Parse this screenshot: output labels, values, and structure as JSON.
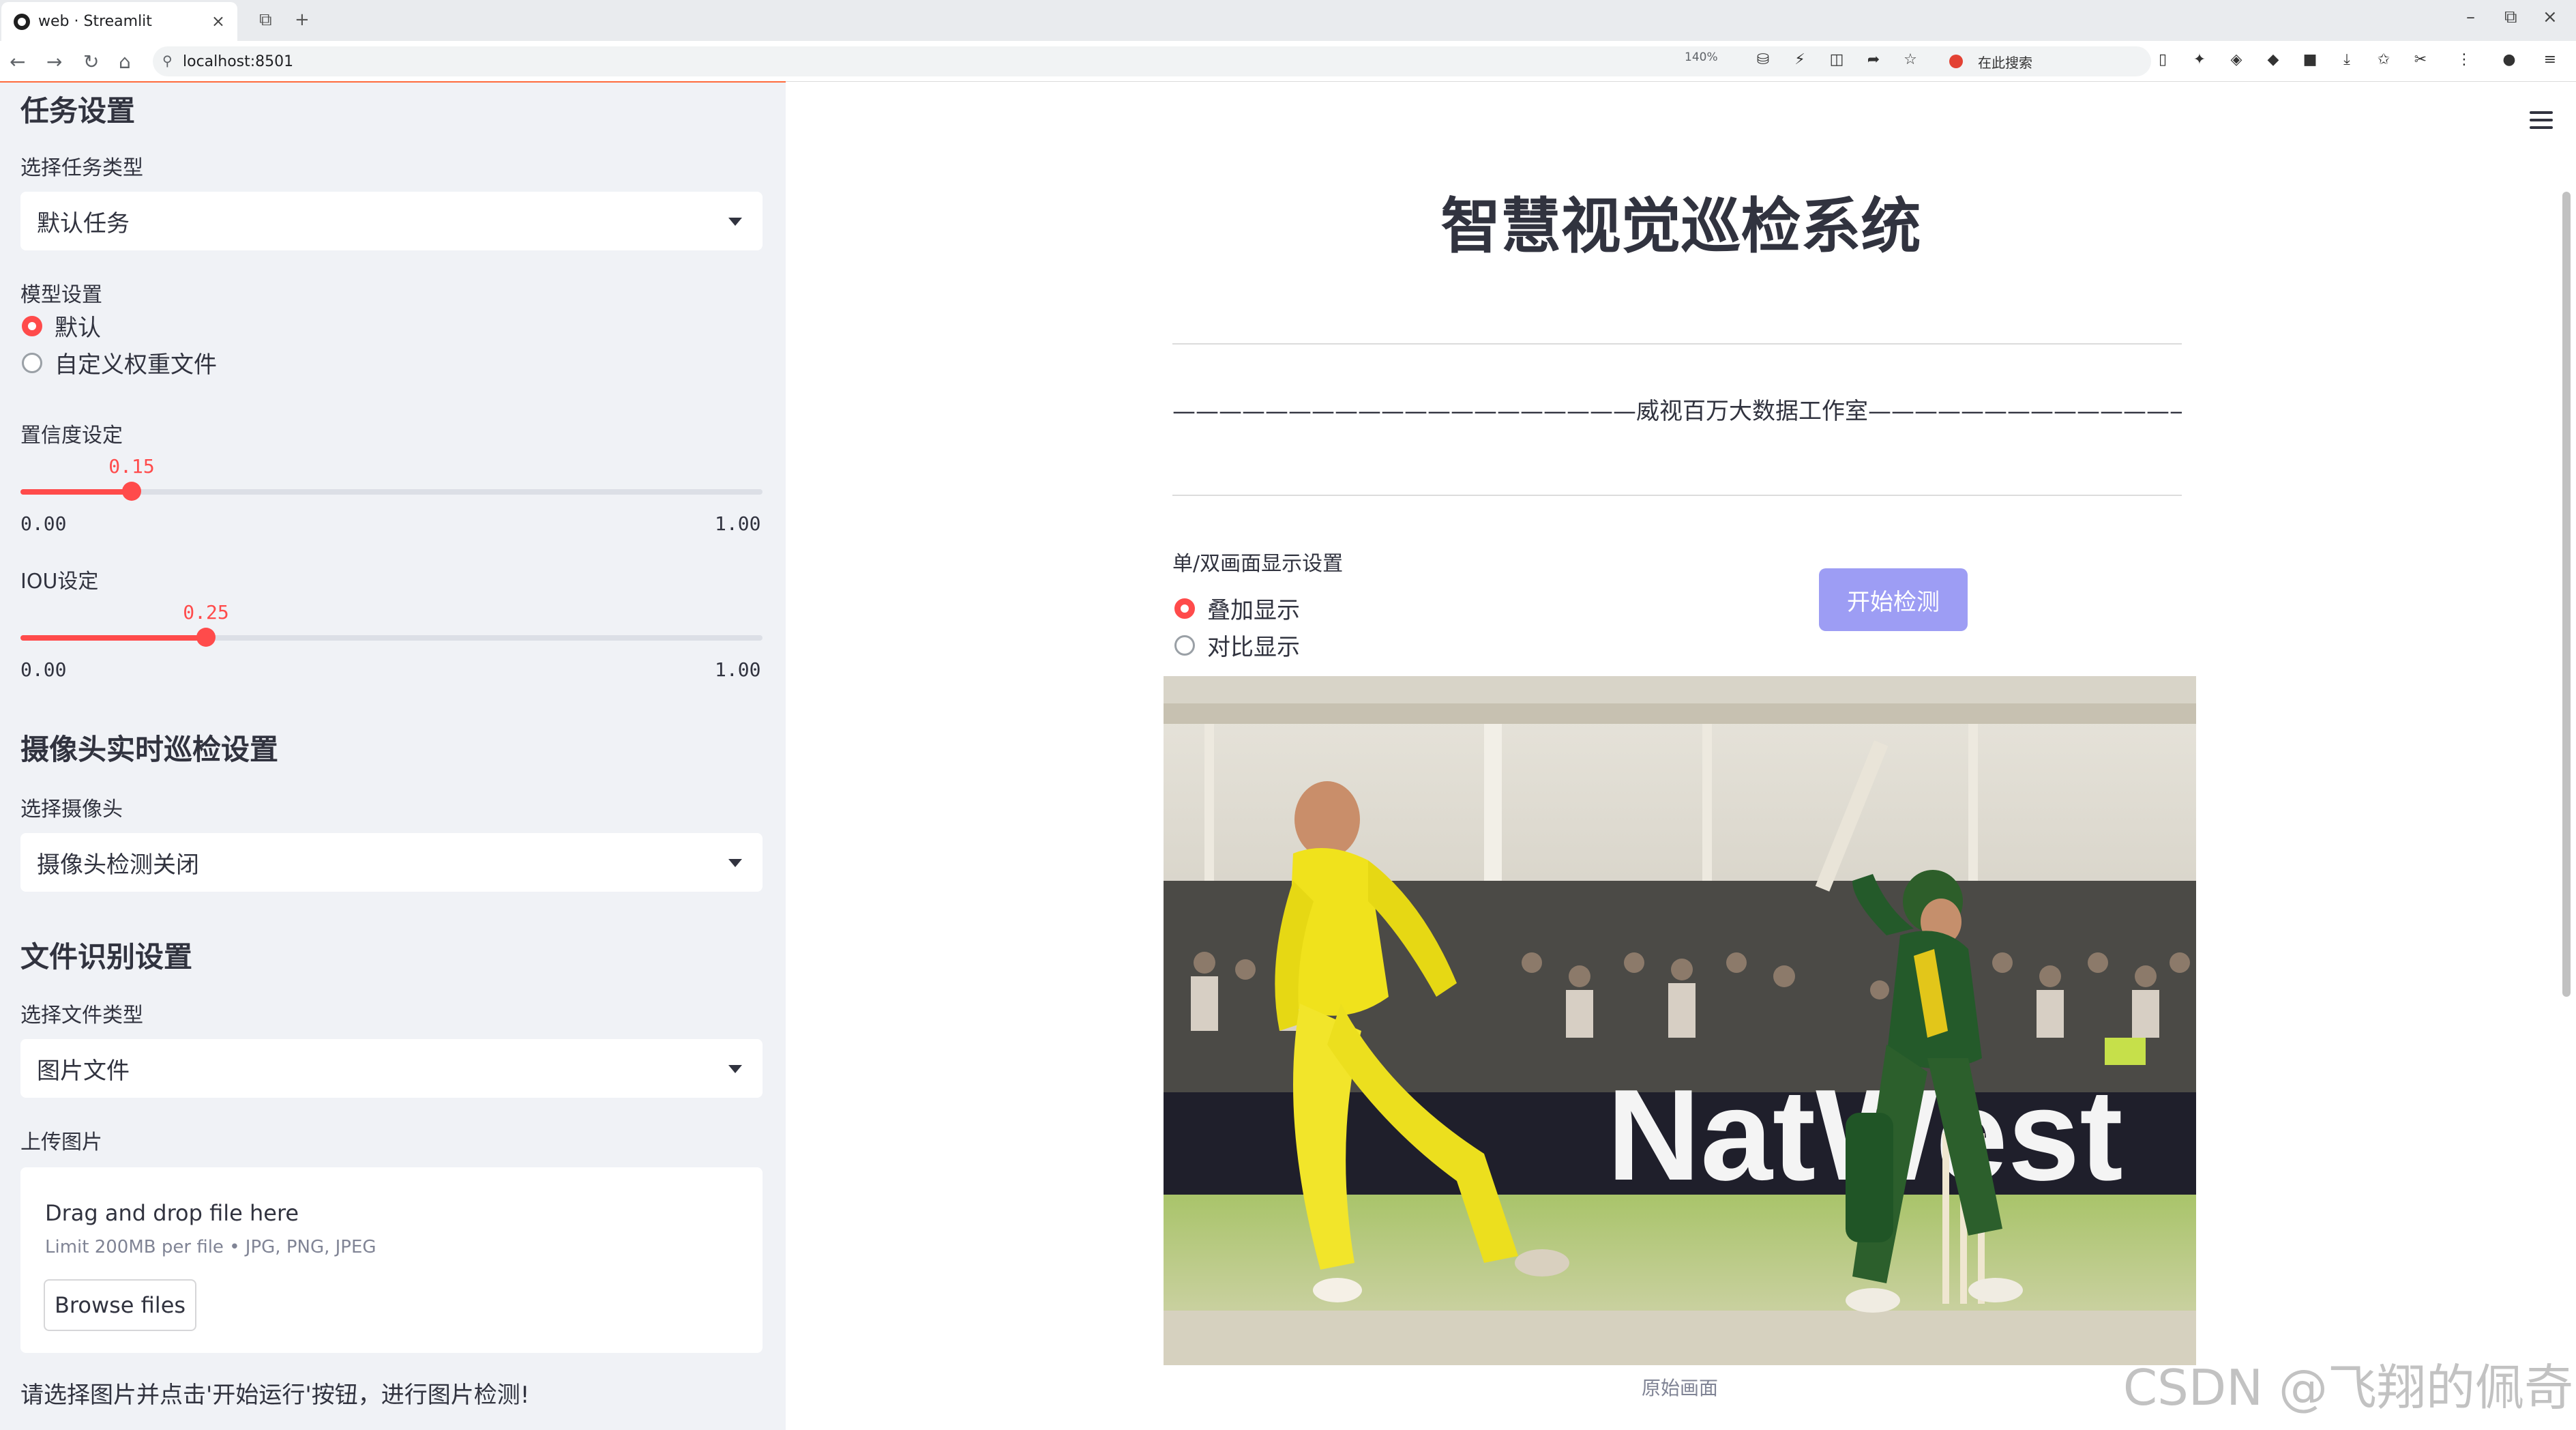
{
  "browser": {
    "tab_title": "web · Streamlit",
    "url": "localhost:8501",
    "zoom": "140%",
    "search_text": "在此搜索"
  },
  "sidebar": {
    "task_section": "任务设置",
    "task_type_label": "选择任务类型",
    "task_type_value": "默认任务",
    "model_label": "模型设置",
    "model_options": [
      "默认",
      "自定义权重文件"
    ],
    "model_selected": "默认",
    "conf_label": "置信度设定",
    "conf_value": "0.15",
    "conf_fraction": 0.15,
    "iou_label": "IOU设定",
    "iou_value": "0.25",
    "iou_fraction": 0.25,
    "slider_min": "0.00",
    "slider_max": "1.00",
    "camera_section": "摄像头实时巡检设置",
    "camera_label": "选择摄像头",
    "camera_value": "摄像头检测关闭",
    "file_section": "文件识别设置",
    "file_type_label": "选择文件类型",
    "file_type_value": "图片文件",
    "upload_label": "上传图片",
    "upload_title": "Drag and drop file here",
    "upload_limit": "Limit 200MB per file • JPG, PNG, JPEG",
    "browse_label": "Browse files",
    "hint": "请选择图片并点击'开始运行'按钮，进行图片检测!"
  },
  "main": {
    "title": "智慧视觉巡检系统",
    "studio": "————————————————————威视百万大数据工作室—————————————————————",
    "display_label": "单/双画面显示设置",
    "display_options": [
      "叠加显示",
      "对比显示"
    ],
    "display_selected": "叠加显示",
    "start_button": "开始检测",
    "image_caption": "原始画面",
    "image_banner_text": "NatWest"
  },
  "watermark": "CSDN @飞翔的佩奇"
}
